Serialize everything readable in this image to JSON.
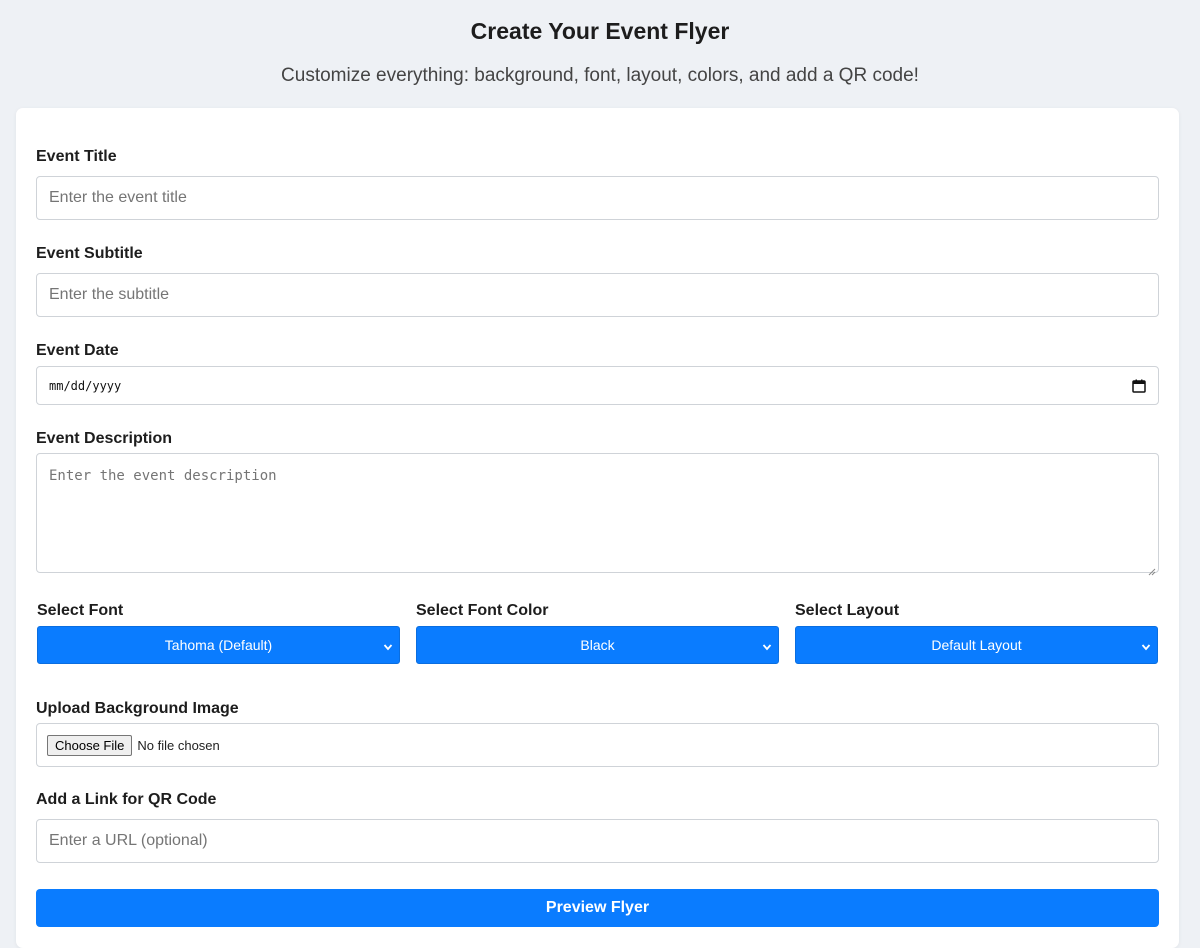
{
  "header": {
    "title": "Create Your Event Flyer",
    "subtitle": "Customize everything: background, font, layout, colors, and add a QR code!"
  },
  "form": {
    "event_title": {
      "label": "Event Title",
      "placeholder": "Enter the event title",
      "value": ""
    },
    "event_subtitle": {
      "label": "Event Subtitle",
      "placeholder": "Enter the subtitle",
      "value": ""
    },
    "event_date": {
      "label": "Event Date",
      "placeholder": "mm/dd/yyyy",
      "icon": "calendar-icon"
    },
    "event_description": {
      "label": "Event Description",
      "placeholder": "Enter the event description"
    },
    "font": {
      "label": "Select Font",
      "selected": "Tahoma (Default)"
    },
    "font_color": {
      "label": "Select Font Color",
      "selected": "Black"
    },
    "layout": {
      "label": "Select Layout",
      "selected": "Default Layout"
    },
    "background_image": {
      "label": "Upload Background Image",
      "button_label": "Choose File",
      "status": "No file chosen"
    },
    "qr_link": {
      "label": "Add a Link for QR Code",
      "placeholder": "Enter a URL (optional)",
      "value": ""
    },
    "submit_label": "Preview Flyer"
  },
  "colors": {
    "accent": "#0a7cff",
    "page_background": "#eef1f5",
    "card_background": "#ffffff"
  }
}
